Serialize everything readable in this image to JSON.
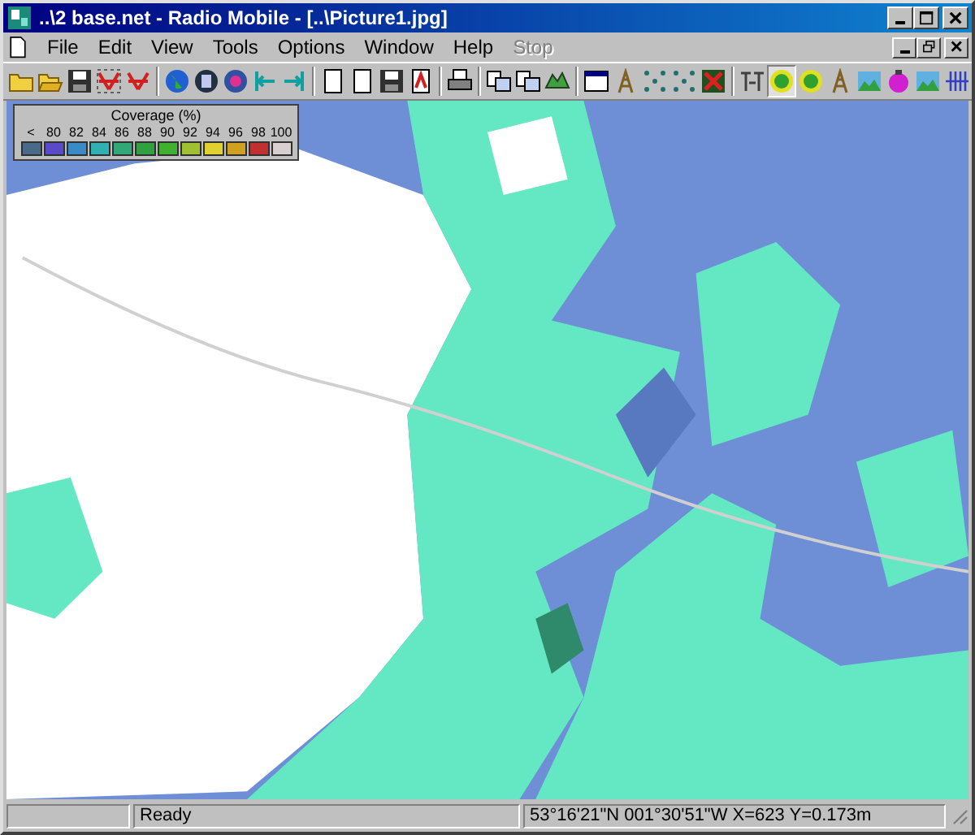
{
  "window": {
    "title": "..\\2 base.net - Radio Mobile - [..\\Picture1.jpg]"
  },
  "menu": [
    {
      "label": "File",
      "disabled": false
    },
    {
      "label": "Edit",
      "disabled": false
    },
    {
      "label": "View",
      "disabled": false
    },
    {
      "label": "Tools",
      "disabled": false
    },
    {
      "label": "Options",
      "disabled": false
    },
    {
      "label": "Window",
      "disabled": false
    },
    {
      "label": "Help",
      "disabled": false
    },
    {
      "label": "Stop",
      "disabled": true
    }
  ],
  "toolbar": [
    [
      {
        "kind": "folder",
        "pressed": false
      },
      {
        "kind": "open",
        "pressed": false
      },
      {
        "kind": "save",
        "pressed": false
      },
      {
        "kind": "network",
        "pressed": false
      },
      {
        "kind": "network-add",
        "pressed": false
      }
    ],
    [
      {
        "kind": "globe",
        "pressed": false
      },
      {
        "kind": "disk",
        "pressed": false
      },
      {
        "kind": "color-disk",
        "pressed": false
      },
      {
        "kind": "arrow-left",
        "pressed": false
      },
      {
        "kind": "arrow-right",
        "pressed": false
      }
    ],
    [
      {
        "kind": "page",
        "pressed": false
      },
      {
        "kind": "page",
        "pressed": false
      },
      {
        "kind": "save",
        "pressed": false
      },
      {
        "kind": "page-red",
        "pressed": false
      }
    ],
    [
      {
        "kind": "printer",
        "pressed": false
      }
    ],
    [
      {
        "kind": "copy",
        "pressed": false
      },
      {
        "kind": "copy",
        "pressed": false
      },
      {
        "kind": "map",
        "pressed": false
      }
    ],
    [
      {
        "kind": "window",
        "pressed": false
      },
      {
        "kind": "tower",
        "pressed": false
      },
      {
        "kind": "dots",
        "pressed": false
      },
      {
        "kind": "dots",
        "pressed": false
      },
      {
        "kind": "cross",
        "pressed": false
      }
    ],
    [
      {
        "kind": "tt",
        "pressed": false
      },
      {
        "kind": "green-circle",
        "pressed": true
      },
      {
        "kind": "green-circle",
        "pressed": false
      },
      {
        "kind": "tower",
        "pressed": false
      },
      {
        "kind": "landscape",
        "pressed": false
      },
      {
        "kind": "ball",
        "pressed": false
      },
      {
        "kind": "landscape",
        "pressed": false
      },
      {
        "kind": "bars",
        "pressed": false
      }
    ]
  ],
  "legend": {
    "title": "Coverage (%)",
    "items": [
      {
        "label": "<",
        "color": "#4a6a8a"
      },
      {
        "label": "80",
        "color": "#5a4ac8"
      },
      {
        "label": "82",
        "color": "#3a8ac8"
      },
      {
        "label": "84",
        "color": "#30b0b0"
      },
      {
        "label": "86",
        "color": "#30a878"
      },
      {
        "label": "88",
        "color": "#30a040"
      },
      {
        "label": "90",
        "color": "#40b030"
      },
      {
        "label": "92",
        "color": "#a0c030"
      },
      {
        "label": "94",
        "color": "#e0d030"
      },
      {
        "label": "96",
        "color": "#d0a020"
      },
      {
        "label": "98",
        "color": "#c03030"
      },
      {
        "label": "100",
        "color": "#d8d0d0"
      }
    ]
  },
  "map": {
    "kind": "picture"
  },
  "status_bar": {
    "message": "Ready",
    "coordinates": "53°16'21\"N 001°30'51\"W  X=623 Y=0.173m"
  }
}
